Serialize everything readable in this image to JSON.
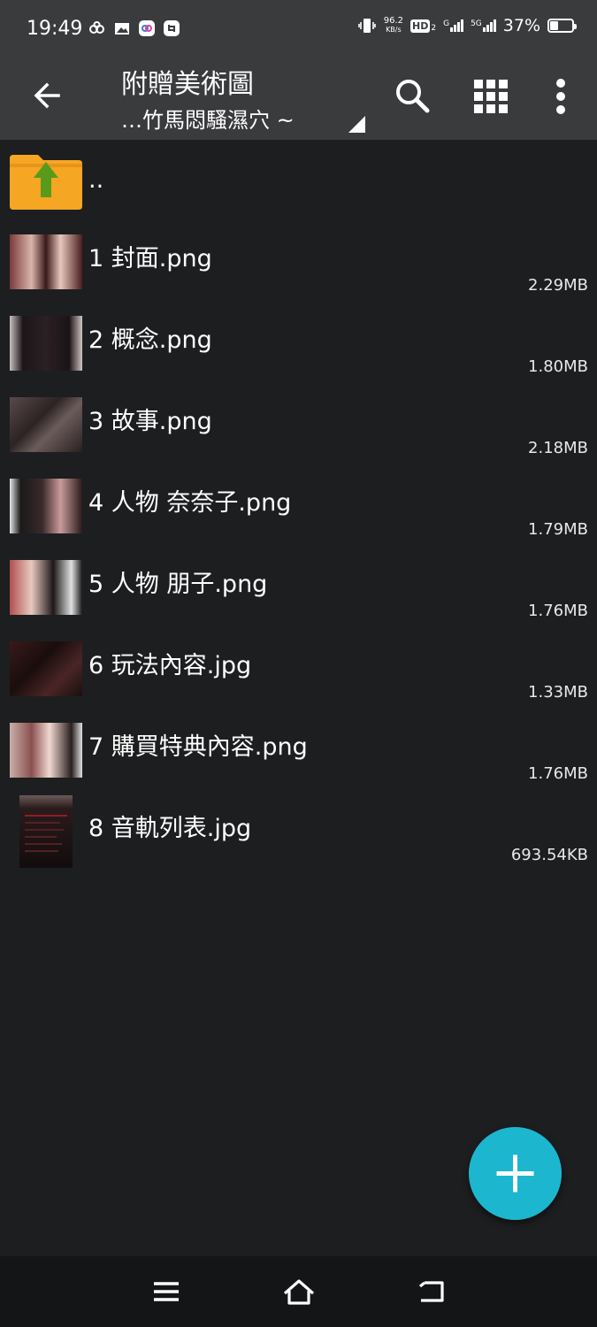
{
  "status_bar": {
    "time": "19:49",
    "net_speed_value": "96.2",
    "net_speed_unit": "KB/s",
    "hd_label": "HD",
    "hd_sub": "2",
    "signal1_label": "G",
    "signal2_label": "5G",
    "battery_text": "37%",
    "battery_level": 0.37
  },
  "toolbar": {
    "title": "附贈美術圖",
    "subtitle": "…竹馬悶騷濕穴 ~"
  },
  "files": [
    {
      "name": "..",
      "size": "",
      "thumb": "folder-up"
    },
    {
      "name": "1 封面.png",
      "size": "2.29MB",
      "thumb": "image"
    },
    {
      "name": "2 概念.png",
      "size": "1.80MB",
      "thumb": "image"
    },
    {
      "name": "3 故事.png",
      "size": "2.18MB",
      "thumb": "image"
    },
    {
      "name": "4 人物 奈奈子.png",
      "size": "1.79MB",
      "thumb": "image"
    },
    {
      "name": "5 人物 朋子.png",
      "size": "1.76MB",
      "thumb": "image"
    },
    {
      "name": "6 玩法內容.jpg",
      "size": "1.33MB",
      "thumb": "image"
    },
    {
      "name": "7 購買特典內容.png",
      "size": "1.76MB",
      "thumb": "image"
    },
    {
      "name": "8 音軌列表.jpg",
      "size": "693.54KB",
      "thumb": "image-portrait"
    }
  ],
  "colors": {
    "background": "#1d1e20",
    "toolbar": "#3a3b3d",
    "fab": "#1cb6cf",
    "folder": "#f5a623",
    "folder_arrow": "#5a9a1a"
  },
  "icons": {
    "back": "arrow-back-icon",
    "search": "search-icon",
    "grid": "grid-view-icon",
    "more": "more-vert-icon",
    "fab": "plus-icon",
    "nav_menu": "menu-icon",
    "nav_home": "home-icon",
    "nav_back": "back-icon"
  }
}
